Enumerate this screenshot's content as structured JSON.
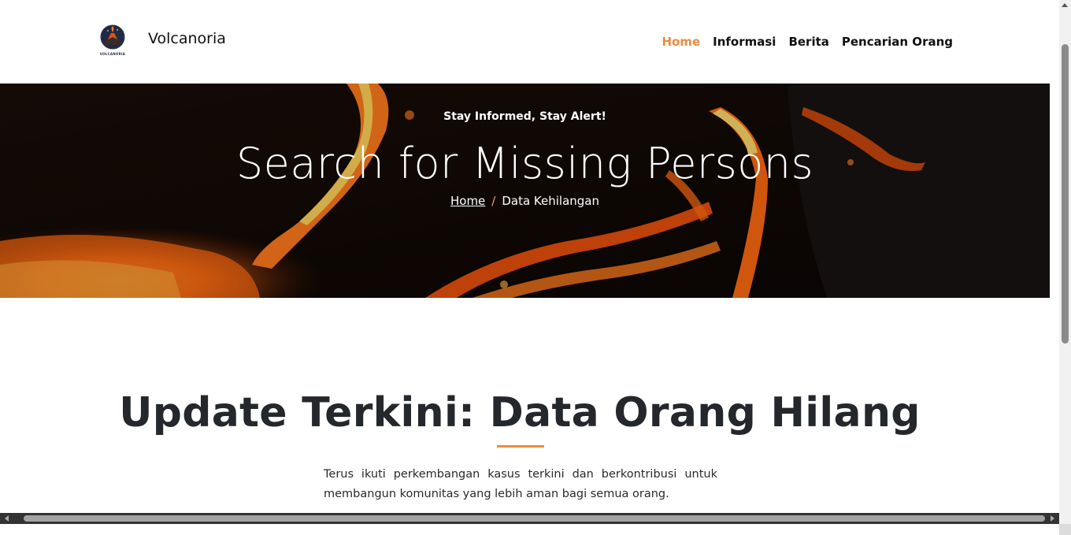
{
  "navbar": {
    "logo_text": "VOLCANORIA",
    "brand": "Volcanoria",
    "links": [
      {
        "label": "Home",
        "active": true
      },
      {
        "label": "Informasi",
        "active": false
      },
      {
        "label": "Berita",
        "active": false
      },
      {
        "label": "Pencarian Orang",
        "active": false
      }
    ]
  },
  "hero": {
    "subtitle": "Stay Informed, Stay Alert!",
    "title": "Search for Missing Persons",
    "breadcrumb": {
      "home": "Home",
      "separator": "/",
      "current": "Data Kehilangan"
    }
  },
  "section": {
    "title": "Update Terkini: Data Orang Hilang",
    "description": "Terus ikuti perkembangan kasus terkini dan berkontribusi untuk membangun komunitas yang lebih aman bagi semua orang."
  },
  "colors": {
    "accent": "#ef8a3a",
    "text_dark": "#24272b",
    "lava": "#ff7a1a"
  }
}
